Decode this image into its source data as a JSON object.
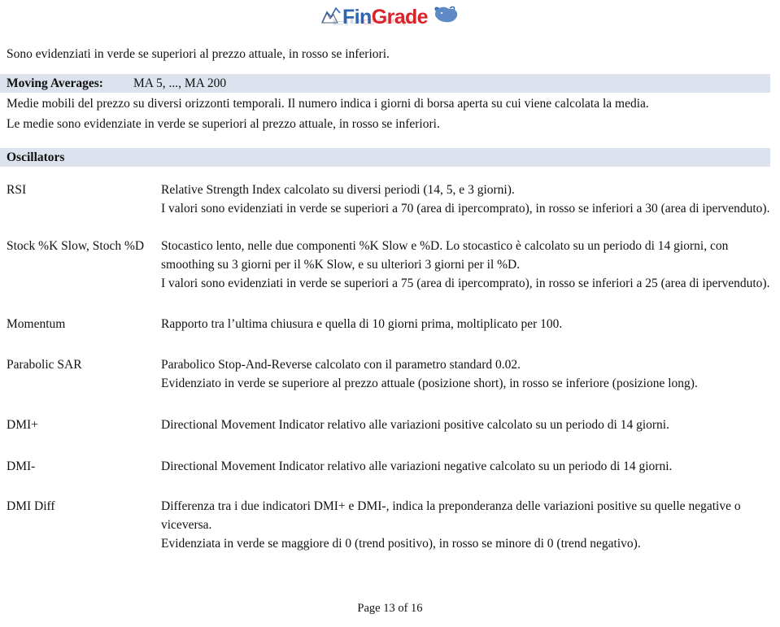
{
  "logo": {
    "name": "FinGrade",
    "part1": "Fin",
    "part2": "Grade",
    "color_fin": "#2e64b0",
    "color_grade": "#d8232a",
    "chart_icon": "mountain-chart-icon",
    "animal_icon": "bull-icon"
  },
  "intro": {
    "line": "Sono evidenziati in verde se superiori al prezzo attuale, in rosso se inferiori."
  },
  "moving_averages": {
    "label": "Moving Averages:",
    "value": "MA 5, ..., MA 200",
    "desc_line1": "Medie mobili del prezzo su diversi orizzonti temporali. Il numero indica i giorni di borsa aperta su cui viene calcolata la media.",
    "desc_line2": "Le medie sono evidenziate in verde se superiori al prezzo attuale, in rosso se inferiori."
  },
  "oscillators": {
    "heading": "Oscillators",
    "items": [
      {
        "term": "RSI",
        "lines": [
          "Relative Strength Index calcolato su diversi periodi (14, 5, e 3 giorni).",
          "I valori sono evidenziati in verde se superiori a 70 (area di ipercomprato), in rosso se inferiori a 30 (area di ipervenduto)."
        ]
      },
      {
        "term": "Stock %K Slow, Stoch %D",
        "lines": [
          "Stocastico lento, nelle due componenti %K Slow e %D. Lo stocastico è calcolato su un periodo di 14 giorni, con smoothing su 3 giorni per il %K Slow, e su ulteriori 3 giorni per il %D.",
          "I valori sono evidenziati in verde se superiori a 75 (area di ipercomprato), in rosso se inferiori a 25 (area di ipervenduto)."
        ]
      },
      {
        "term": "Momentum",
        "lines": [
          "Rapporto tra l’ultima chiusura e quella di 10 giorni prima, moltiplicato per 100."
        ]
      },
      {
        "term": "Parabolic SAR",
        "lines": [
          "Parabolico Stop-And-Reverse calcolato con il parametro standard 0.02.",
          "Evidenziato in verde se superiore al prezzo attuale (posizione short), in rosso se inferiore (posizione long)."
        ]
      },
      {
        "term": "DMI+",
        "lines": [
          "Directional Movement Indicator relativo alle variazioni positive calcolato su un periodo di 14 giorni."
        ]
      },
      {
        "term": "DMI-",
        "lines": [
          "Directional Movement Indicator relativo alle variazioni negative calcolato su un periodo di 14 giorni."
        ]
      },
      {
        "term": "DMI Diff",
        "lines": [
          "Differenza tra i due indicatori DMI+ e DMI-, indica la preponderanza delle variazioni positive su quelle negative o viceversa.",
          "Evidenziata in verde se maggiore di 0 (trend positivo), in rosso se minore di 0 (trend negativo)."
        ]
      }
    ]
  },
  "footer": {
    "page_label": "Page 13 of 16"
  },
  "colors": {
    "band_background": "#dde3ee",
    "text": "#111111"
  }
}
